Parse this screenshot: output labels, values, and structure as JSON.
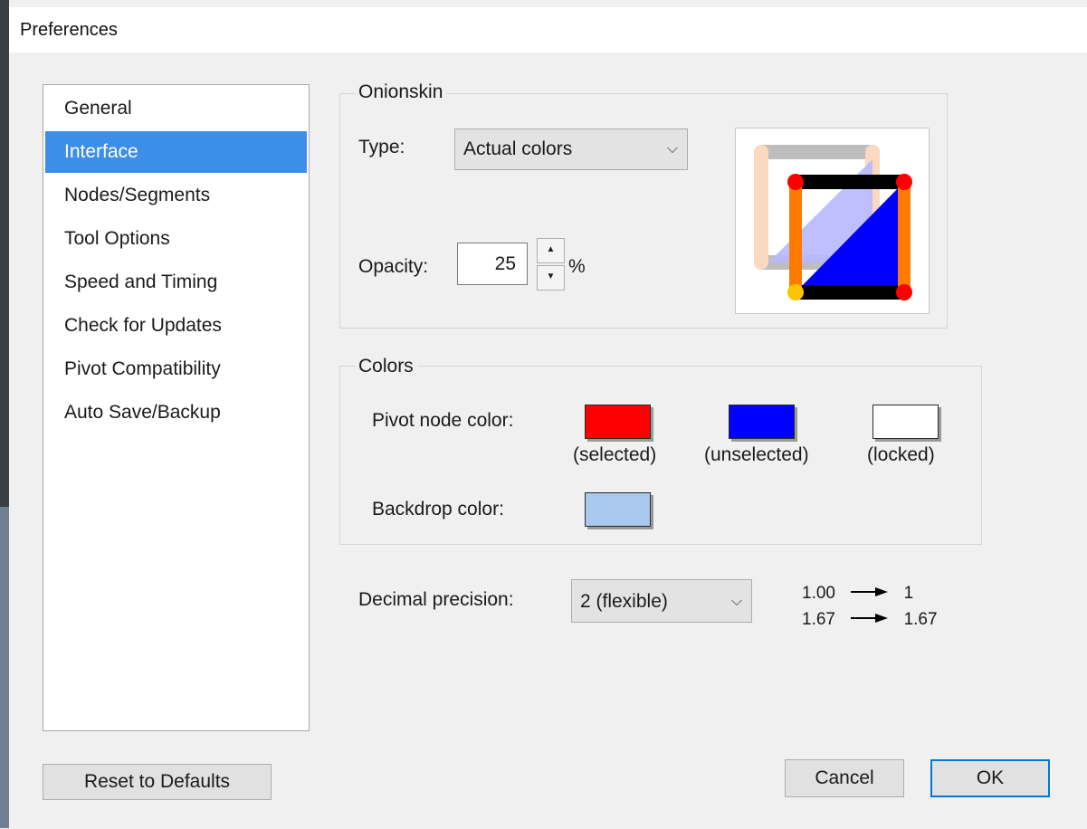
{
  "window": {
    "title": "Preferences"
  },
  "sidebar": {
    "items": [
      {
        "label": "General",
        "selected": false
      },
      {
        "label": "Interface",
        "selected": true
      },
      {
        "label": "Nodes/Segments",
        "selected": false
      },
      {
        "label": "Tool Options",
        "selected": false
      },
      {
        "label": "Speed and Timing",
        "selected": false
      },
      {
        "label": "Check for Updates",
        "selected": false
      },
      {
        "label": "Pivot Compatibility",
        "selected": false
      },
      {
        "label": "Auto Save/Backup",
        "selected": false
      }
    ]
  },
  "onionskin": {
    "group_label": "Onionskin",
    "type_label": "Type:",
    "type_value": "Actual colors",
    "opacity_label": "Opacity:",
    "opacity_value": "25",
    "opacity_unit": "%"
  },
  "colors": {
    "group_label": "Colors",
    "pivot_label": "Pivot node color:",
    "swatches": [
      {
        "caption": "(selected)",
        "color": "#ff0000"
      },
      {
        "caption": "(unselected)",
        "color": "#0000ff"
      },
      {
        "caption": "(locked)",
        "color": "#ffffff"
      }
    ],
    "backdrop_label": "Backdrop color:",
    "backdrop_color": "#a8c8f0"
  },
  "precision": {
    "label": "Decimal precision:",
    "value": "2 (flexible)",
    "examples": [
      {
        "from": "1.00",
        "to": "1"
      },
      {
        "from": "1.67",
        "to": "1.67"
      }
    ]
  },
  "buttons": {
    "reset": "Reset to Defaults",
    "cancel": "Cancel",
    "ok": "OK"
  },
  "icons": {
    "type_dropdown": "chevron-down-icon",
    "precision_dropdown": "chevron-down-icon",
    "spin_up": "triangle-up-icon",
    "spin_down": "triangle-down-icon",
    "arrow": "arrow-right-icon",
    "preview": "onionskin-preview-figure"
  }
}
